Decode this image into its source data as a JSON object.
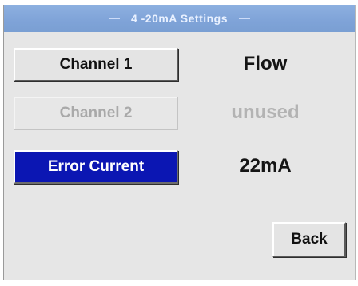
{
  "title": "4 -20mA Settings",
  "buttons": {
    "channel1": "Channel 1",
    "channel2": "Channel 2",
    "error_current": "Error Current",
    "back": "Back"
  },
  "values": {
    "channel1": "Flow",
    "channel2": "unused",
    "error_current": "22mA"
  },
  "colors": {
    "titlebar": "#7fa3d8",
    "screen_bg": "#e6e6e6",
    "selected_button": "#0b16b3",
    "disabled_text": "#a9a9a9"
  }
}
